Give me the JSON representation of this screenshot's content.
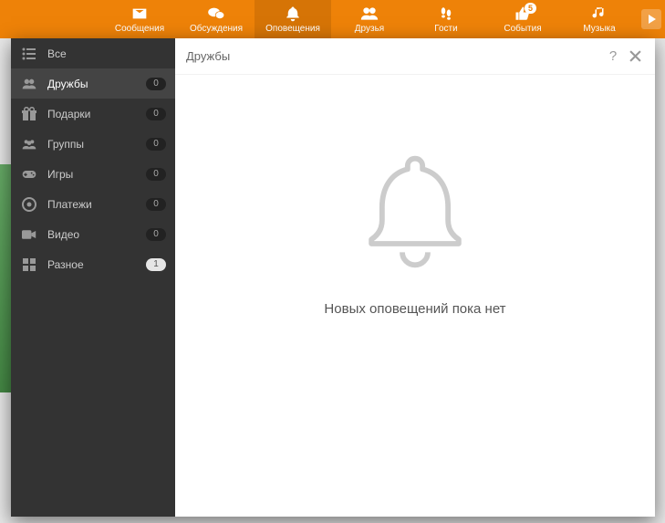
{
  "nav": [
    {
      "id": "messages",
      "label": "Сообщения",
      "icon": "envelope",
      "active": false
    },
    {
      "id": "discussions",
      "label": "Обсуждения",
      "icon": "comments",
      "active": false
    },
    {
      "id": "notifications",
      "label": "Оповещения",
      "icon": "bell",
      "active": true
    },
    {
      "id": "friends",
      "label": "Друзья",
      "icon": "friends",
      "active": false
    },
    {
      "id": "guests",
      "label": "Гости",
      "icon": "footprints",
      "active": false
    },
    {
      "id": "events",
      "label": "События",
      "icon": "thumb",
      "active": false,
      "badge": "5"
    },
    {
      "id": "music",
      "label": "Музыка",
      "icon": "music",
      "active": false
    }
  ],
  "sidebar": {
    "items": [
      {
        "id": "all",
        "label": "Все",
        "icon": "list",
        "count": null,
        "active": false
      },
      {
        "id": "friendship",
        "label": "Дружбы",
        "icon": "friends",
        "count": "0",
        "active": true
      },
      {
        "id": "gifts",
        "label": "Подарки",
        "icon": "gift",
        "count": "0",
        "active": false
      },
      {
        "id": "groups",
        "label": "Группы",
        "icon": "group",
        "count": "0",
        "active": false
      },
      {
        "id": "games",
        "label": "Игры",
        "icon": "gamepad",
        "count": "0",
        "active": false
      },
      {
        "id": "payments",
        "label": "Платежи",
        "icon": "payments",
        "count": "0",
        "active": false
      },
      {
        "id": "video",
        "label": "Видео",
        "icon": "video",
        "count": "0",
        "active": false
      },
      {
        "id": "other",
        "label": "Разное",
        "icon": "grid",
        "count": "1",
        "countLight": true,
        "active": false
      }
    ]
  },
  "content": {
    "title": "Дружбы",
    "emptyMessage": "Новых оповещений пока нет"
  }
}
